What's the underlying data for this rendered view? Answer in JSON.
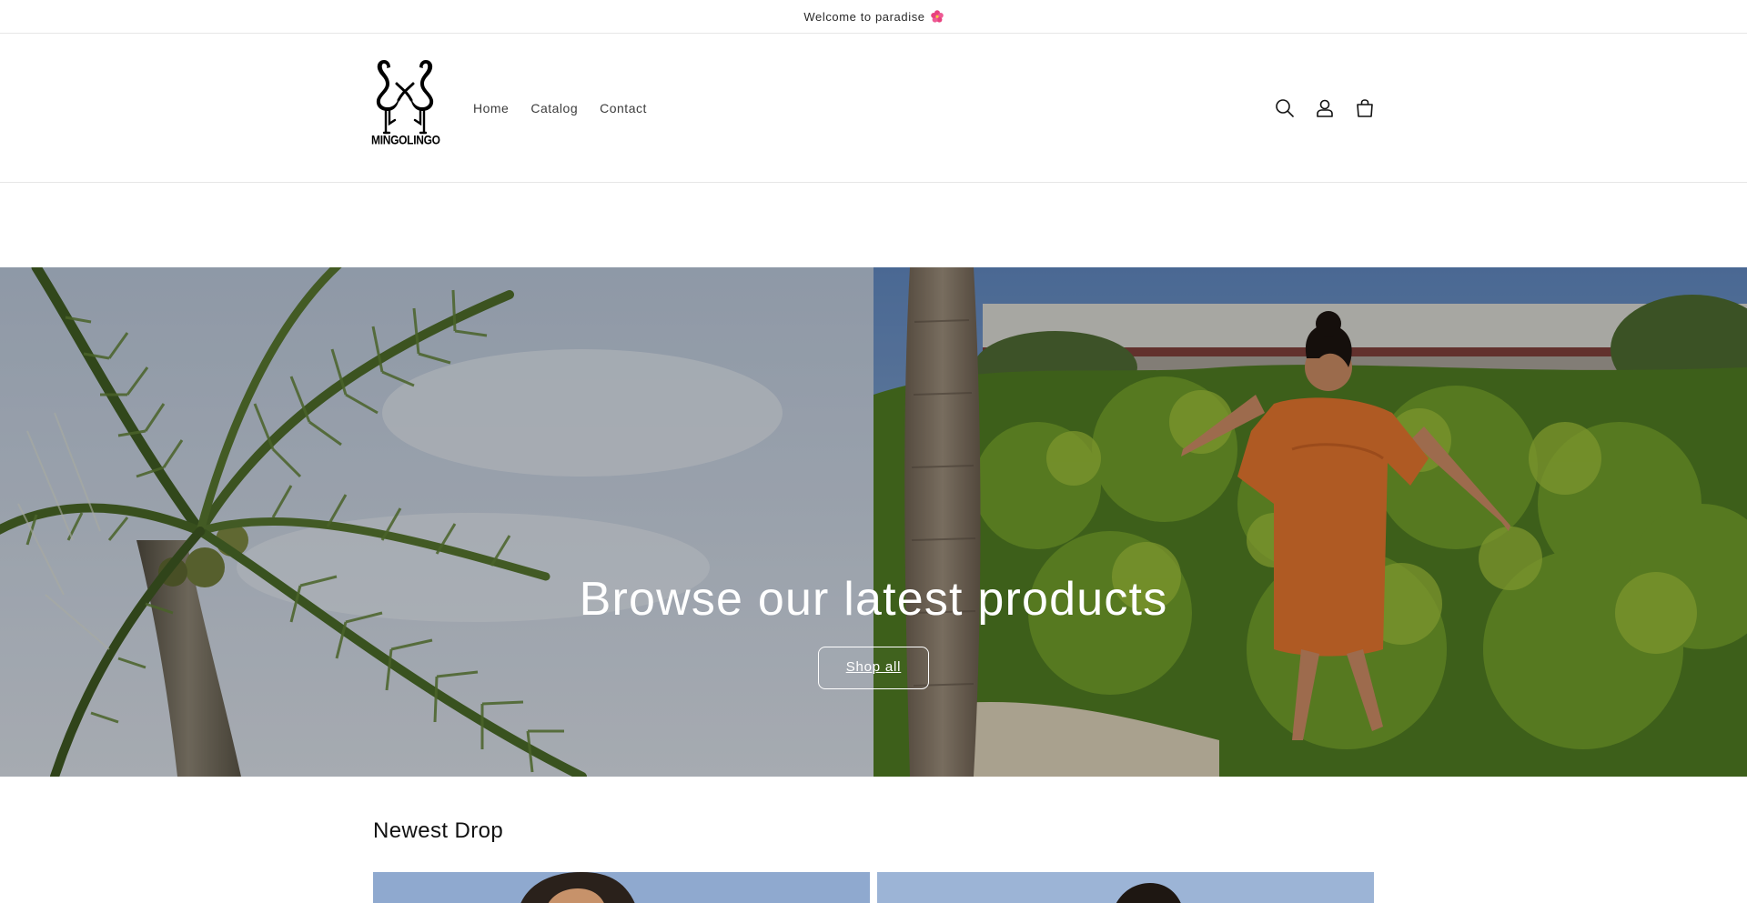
{
  "announcement": {
    "text": "Welcome to paradise",
    "icon": "hibiscus-icon"
  },
  "header": {
    "logo_text": "MINGOLINGO",
    "nav": [
      {
        "label": "Home"
      },
      {
        "label": "Catalog"
      },
      {
        "label": "Contact"
      }
    ],
    "icons": [
      "search-icon",
      "account-icon",
      "cart-icon"
    ]
  },
  "hero": {
    "title": "Browse our latest products",
    "button_label": "Shop all"
  },
  "collection": {
    "title": "Newest Drop"
  },
  "colors": {
    "text": "#121212",
    "border": "#e6e6e6",
    "accent_pink": "#e83e8c",
    "button_text": "#ffffff"
  }
}
